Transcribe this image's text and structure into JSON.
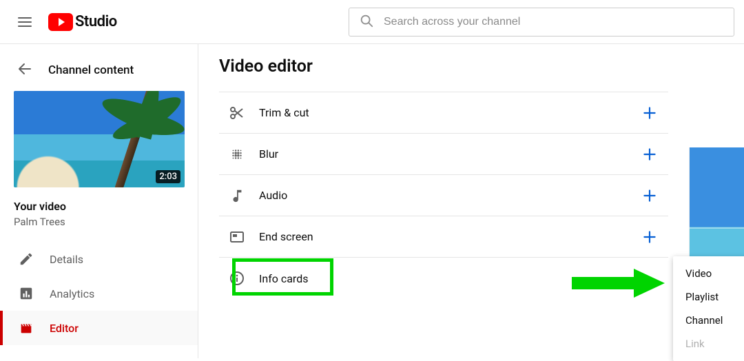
{
  "header": {
    "logo_text": "Studio",
    "search_placeholder": "Search across your channel"
  },
  "sidebar": {
    "back_label": "Channel content",
    "video_duration": "2:03",
    "your_video_label": "Your video",
    "video_title": "Palm Trees",
    "nav": [
      {
        "id": "details",
        "label": "Details",
        "icon": "pencil-icon"
      },
      {
        "id": "analytics",
        "label": "Analytics",
        "icon": "bar-chart-icon"
      },
      {
        "id": "editor",
        "label": "Editor",
        "icon": "clapper-icon",
        "active": true
      }
    ]
  },
  "main": {
    "title": "Video editor",
    "rows": [
      {
        "id": "trim",
        "label": "Trim & cut",
        "icon": "scissors-icon",
        "plus": true
      },
      {
        "id": "blur",
        "label": "Blur",
        "icon": "blur-icon",
        "plus": true
      },
      {
        "id": "audio",
        "label": "Audio",
        "icon": "music-note-icon",
        "plus": true
      },
      {
        "id": "endscreen",
        "label": "End screen",
        "icon": "end-screen-icon",
        "plus": true
      },
      {
        "id": "infocards",
        "label": "Info cards",
        "icon": "info-icon",
        "plus": false,
        "highlighted": true
      }
    ],
    "info_cards_menu": [
      {
        "label": "Video",
        "disabled": false
      },
      {
        "label": "Playlist",
        "disabled": false
      },
      {
        "label": "Channel",
        "disabled": false
      },
      {
        "label": "Link",
        "disabled": true
      }
    ]
  },
  "annotations": {
    "highlight_color": "#00d400",
    "accent_blue": "#065fd4",
    "brand_red": "#cc0000"
  }
}
